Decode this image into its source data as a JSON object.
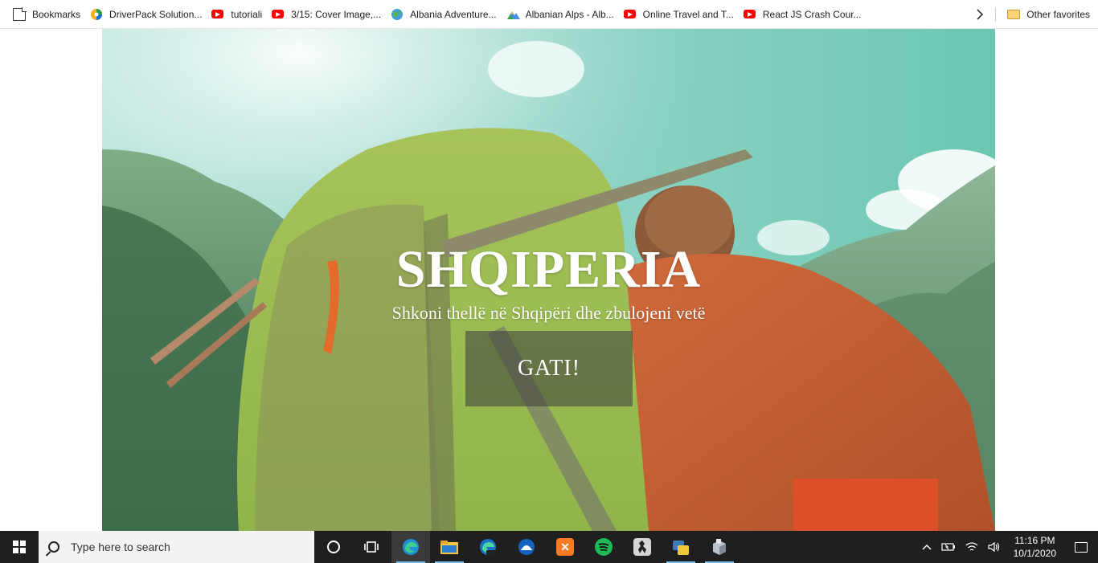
{
  "bookmarks_bar": {
    "items": [
      {
        "label": "Bookmarks",
        "icon": "document-icon"
      },
      {
        "label": "DriverPack Solution...",
        "icon": "driverpack-icon"
      },
      {
        "label": "tutoriali",
        "icon": "youtube-icon"
      },
      {
        "label": "3/15: Cover Image,...",
        "icon": "youtube-icon"
      },
      {
        "label": "Albania Adventure...",
        "icon": "globe-icon"
      },
      {
        "label": "Albanian Alps - Alb...",
        "icon": "mountain-icon"
      },
      {
        "label": "Online Travel and T...",
        "icon": "youtube-icon"
      },
      {
        "label": "React JS Crash Cour...",
        "icon": "youtube-icon"
      }
    ],
    "overflow_icon": "chevron-right-icon",
    "other_favorites": "Other favorites"
  },
  "hero": {
    "title": "SHQIPERIA",
    "subtitle": "Shkoni thellë në Shqipëri dhe zbulojeni vetë",
    "cta_label": "GATI!"
  },
  "taskbar": {
    "search_placeholder": "Type here to search",
    "apps": [
      "cortana-icon",
      "task-view-icon",
      "edge-icon",
      "file-explorer-icon",
      "edge-beta-icon",
      "app-blue-icon",
      "xampp-icon",
      "spotify-icon",
      "counter-strike-icon",
      "python-icon",
      "app-box-icon"
    ],
    "clock_time": "11:16 PM",
    "clock_date": "10/1/2020"
  },
  "colors": {
    "youtube_red": "#ff0000",
    "taskbar_bg": "#1f1f1f",
    "active_indicator": "#76b9ed",
    "cta_bg": "rgba(60,60,60,0.55)"
  }
}
